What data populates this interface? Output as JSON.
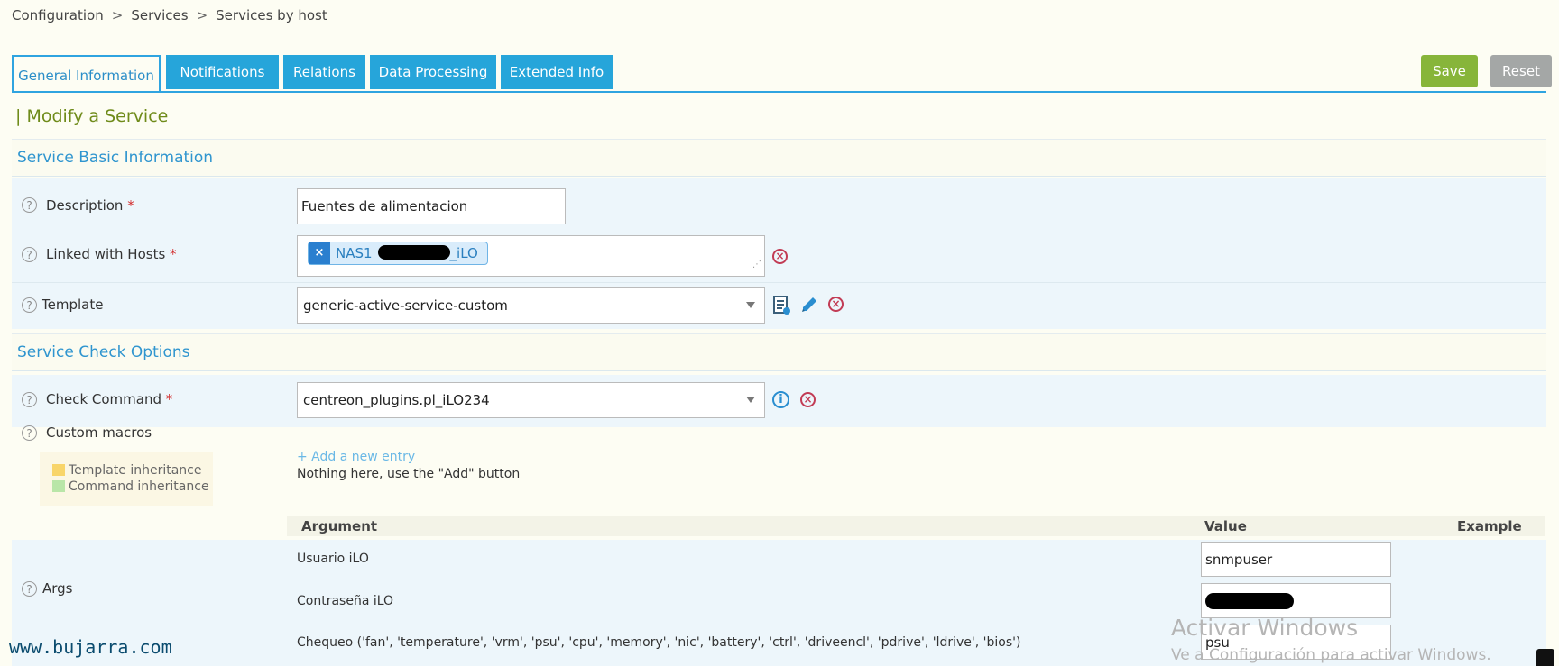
{
  "breadcrumb": {
    "items": [
      "Configuration",
      "Services",
      "Services by host"
    ],
    "separator": ">"
  },
  "tabs": [
    {
      "label": "General Information",
      "active": true
    },
    {
      "label": "Notifications"
    },
    {
      "label": "Relations"
    },
    {
      "label": "Data Processing"
    },
    {
      "label": "Extended Info"
    }
  ],
  "actions": {
    "save": "Save",
    "reset": "Reset"
  },
  "page_title": "| Modify a Service",
  "sections": {
    "basic": "Service Basic Information",
    "check": "Service Check Options"
  },
  "fields": {
    "description": {
      "label": "Description",
      "value": "Fuentes de alimentacion"
    },
    "hosts": {
      "label": "Linked with Hosts",
      "chip_start": "NAS1",
      "chip_end": "_iLO"
    },
    "template": {
      "label": "Template",
      "value": "generic-active-service-custom"
    },
    "check_command": {
      "label": "Check Command",
      "value": "centreon_plugins.pl_iLO234"
    },
    "custom_macros": {
      "label": "Custom macros",
      "add_link": "+ Add a new entry",
      "empty_msg": "Nothing here, use the \"Add\" button",
      "legend": [
        "Template inheritance",
        "Command inheritance"
      ]
    },
    "args": {
      "label": "Args",
      "headers": {
        "argument": "Argument",
        "value": "Value",
        "example": "Example"
      },
      "rows": [
        {
          "argument": "Usuario iLO",
          "value": "snmpuser"
        },
        {
          "argument": "Contraseña iLO",
          "value": ""
        },
        {
          "argument": "Chequeo ('fan', 'temperature', 'vrm', 'psu', 'cpu', 'memory', 'nic', 'battery', 'ctrl', 'driveencl', 'pdrive', 'ldrive', 'bios')",
          "value": "psu"
        }
      ]
    }
  },
  "required_marker": "*",
  "help_glyph": "?",
  "watermark": {
    "line1": "Activar Windows",
    "line2": "Ve a Configuración para activar Windows."
  },
  "site": "www.bujarra.com",
  "colors": {
    "tab": "#26a5da",
    "save": "#87b53a",
    "reset": "#a4a7a6",
    "title": "#6f8b1a",
    "section": "#2f95cf",
    "remove": "#c23c55"
  },
  "icons": [
    "remove-icon",
    "template-view-icon",
    "edit-pencil-icon",
    "info-icon",
    "help-icon",
    "dropdown-caret-icon"
  ]
}
